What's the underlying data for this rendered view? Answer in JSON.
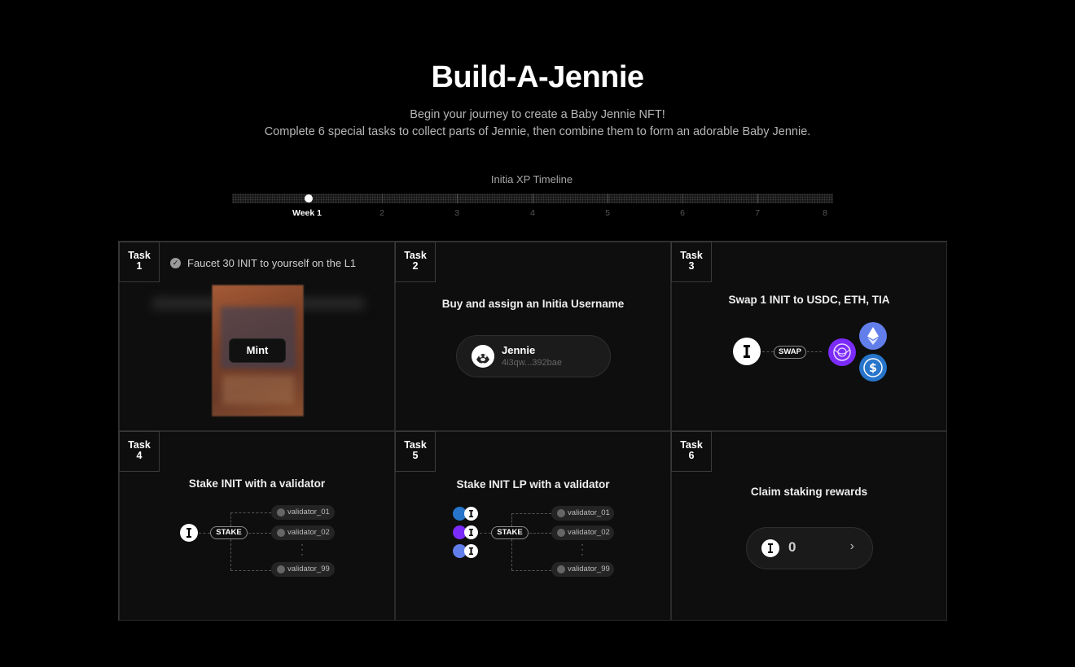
{
  "header": {
    "title": "Build-A-Jennie",
    "subtitle_line1": "Begin your journey to create a Baby Jennie NFT!",
    "subtitle_line2": "Complete 6 special tasks to collect parts of Jennie, then combine them to form an adorable Baby Jennie."
  },
  "timeline": {
    "label": "Initia XP Timeline",
    "weeks": [
      "Week 1",
      "2",
      "3",
      "4",
      "5",
      "6",
      "7",
      "8"
    ],
    "current_week": 1
  },
  "tasks": [
    {
      "tag_line1": "Task",
      "tag_line2": "1",
      "title": "Faucet 30 INIT to yourself on the L1",
      "completed": true,
      "button": "Mint"
    },
    {
      "tag_line1": "Task",
      "tag_line2": "2",
      "title": "Buy and assign an Initia Username",
      "username": "Jennie",
      "address": "4i3qw...392bae"
    },
    {
      "tag_line1": "Task",
      "tag_line2": "3",
      "title": "Swap 1 INIT to USDC, ETH, TIA",
      "swap_label": "SWAP"
    },
    {
      "tag_line1": "Task",
      "tag_line2": "4",
      "title": "Stake INIT with a validator",
      "stake_label": "STAKE",
      "validators": [
        "validator_01",
        "validator_02",
        "validator_99"
      ]
    },
    {
      "tag_line1": "Task",
      "tag_line2": "5",
      "title": "Stake INIT LP with a validator",
      "stake_label": "STAKE",
      "validators": [
        "validator_01",
        "validator_02",
        "validator_99"
      ]
    },
    {
      "tag_line1": "Task",
      "tag_line2": "6",
      "title": "Claim staking rewards",
      "rewards_value": "0"
    }
  ],
  "colors": {
    "background": "#000000",
    "panel": "#0e0e0e",
    "usdc": "#2775ca",
    "eth": "#627eea",
    "tia": "#7b2bf9"
  }
}
